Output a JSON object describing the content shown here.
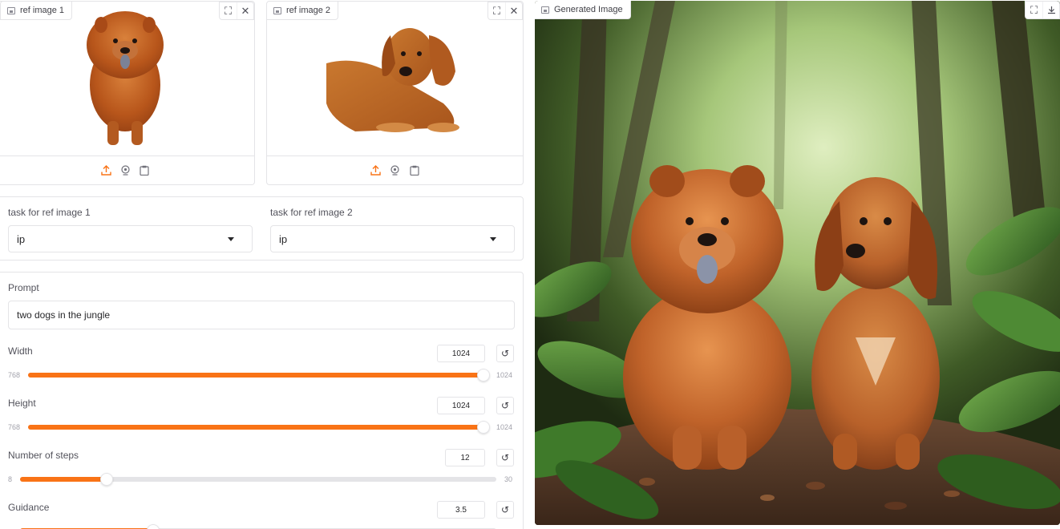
{
  "ref1": {
    "label": "ref image 1"
  },
  "ref2": {
    "label": "ref image 2"
  },
  "output": {
    "label": "Generated Image"
  },
  "tasks": {
    "task1_label": "task for ref image 1",
    "task1_value": "ip",
    "task2_label": "task for ref image 2",
    "task2_value": "ip"
  },
  "prompt": {
    "label": "Prompt",
    "value": "two dogs in the jungle"
  },
  "sliders": [
    {
      "label": "Width",
      "value": "1024",
      "min": "768",
      "max": "1024",
      "fraction": 1.0
    },
    {
      "label": "Height",
      "value": "1024",
      "min": "768",
      "max": "1024",
      "fraction": 1.0
    },
    {
      "label": "Number of steps",
      "value": "12",
      "min": "8",
      "max": "30",
      "fraction": 0.1818
    },
    {
      "label": "Guidance",
      "value": "3.5",
      "min": "",
      "max": "",
      "fraction": 0.28
    }
  ],
  "colors": {
    "accent": "#f97316",
    "border": "#e4e4e7"
  },
  "icons": [
    "image-icon",
    "fullscreen-icon",
    "close-icon",
    "download-icon",
    "upload-icon",
    "webcam-icon",
    "clipboard-icon",
    "chevron-down-icon",
    "reset-icon"
  ]
}
